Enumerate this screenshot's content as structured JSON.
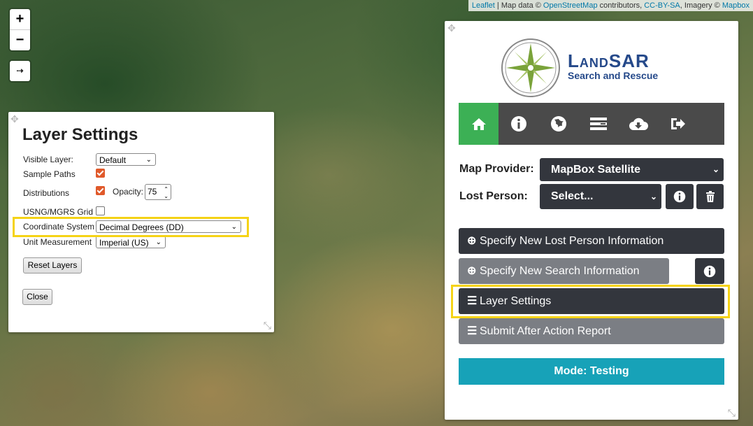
{
  "map": {
    "attribution": {
      "leaflet": "Leaflet",
      "sep": " | Map data © ",
      "osm": "OpenStreetMap",
      "contrib": " contributors, ",
      "license": "CC-BY-SA",
      "imagery": ", Imagery © ",
      "mapbox": "Mapbox"
    },
    "zoom_in": "+",
    "zoom_out": "−",
    "arrow_icon": "⇢"
  },
  "layer_settings": {
    "title": "Layer Settings",
    "visible_layer_label": "Visible Layer:",
    "visible_layer_value": "Default",
    "sample_paths_label": "Sample Paths",
    "sample_paths_checked": true,
    "distributions_label": "Distributions",
    "distributions_checked": true,
    "opacity_label": "Opacity:",
    "opacity_value": "75",
    "usng_label": "USNG/MGRS Grid",
    "usng_checked": false,
    "coordinate_label": "Coordinate System",
    "coordinate_value": "Decimal Degrees (DD)",
    "unit_label": "Unit Measurement",
    "unit_value": "Imperial (US)",
    "reset_button": "Reset Layers",
    "close_button": "Close"
  },
  "main_panel": {
    "logo_title": "LandSAR",
    "logo_subtitle": "Search and Rescue",
    "nav": [
      "home-icon",
      "info-icon",
      "globe-icon",
      "list-icon",
      "cloud-download-icon",
      "sign-out-icon"
    ],
    "map_provider_label": "Map Provider:",
    "map_provider_value": "MapBox Satellite",
    "lost_person_label": "Lost Person:",
    "lost_person_value": "Select...",
    "buttons": {
      "lost_person": "Specify New Lost Person Information",
      "search_info": "Specify New Search Information",
      "layer_settings": "Layer Settings",
      "after_action": "Submit After Action Report"
    },
    "mode": "Mode: Testing"
  },
  "colors": {
    "highlight": "#f5d316",
    "nav_active": "#3cb055",
    "mode_bar": "#17a2b8",
    "dark_button": "#33363d",
    "checkbox": "#e0592a"
  }
}
